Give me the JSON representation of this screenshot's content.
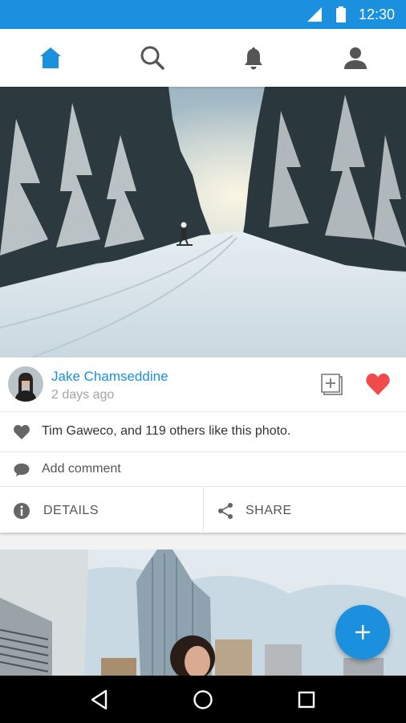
{
  "status_bar": {
    "time": "12:30",
    "signal_icon": "cell-signal-icon",
    "battery_icon": "battery-icon"
  },
  "nav": {
    "tabs": [
      {
        "name": "home",
        "icon": "home-icon",
        "active": true
      },
      {
        "name": "search",
        "icon": "search-icon",
        "active": false
      },
      {
        "name": "notifications",
        "icon": "bell-icon",
        "active": false
      },
      {
        "name": "profile",
        "icon": "person-icon",
        "active": false
      }
    ]
  },
  "post": {
    "image": "snowy-forest-skier-photo",
    "author": "Jake Chamseddine",
    "time_ago": "2 days ago",
    "likes_text": "Tim Gaweco, and 119 others like this photo.",
    "comment_placeholder": "Add comment",
    "details_label": "DETAILS",
    "share_label": "SHARE",
    "liked": true
  },
  "next_post": {
    "image": "city-skyscraper-woman-photo"
  },
  "fab": {
    "icon": "plus-icon"
  },
  "colors": {
    "accent": "#1a90de",
    "heart": "#f24a4a",
    "status_bar": "#1a90de"
  }
}
